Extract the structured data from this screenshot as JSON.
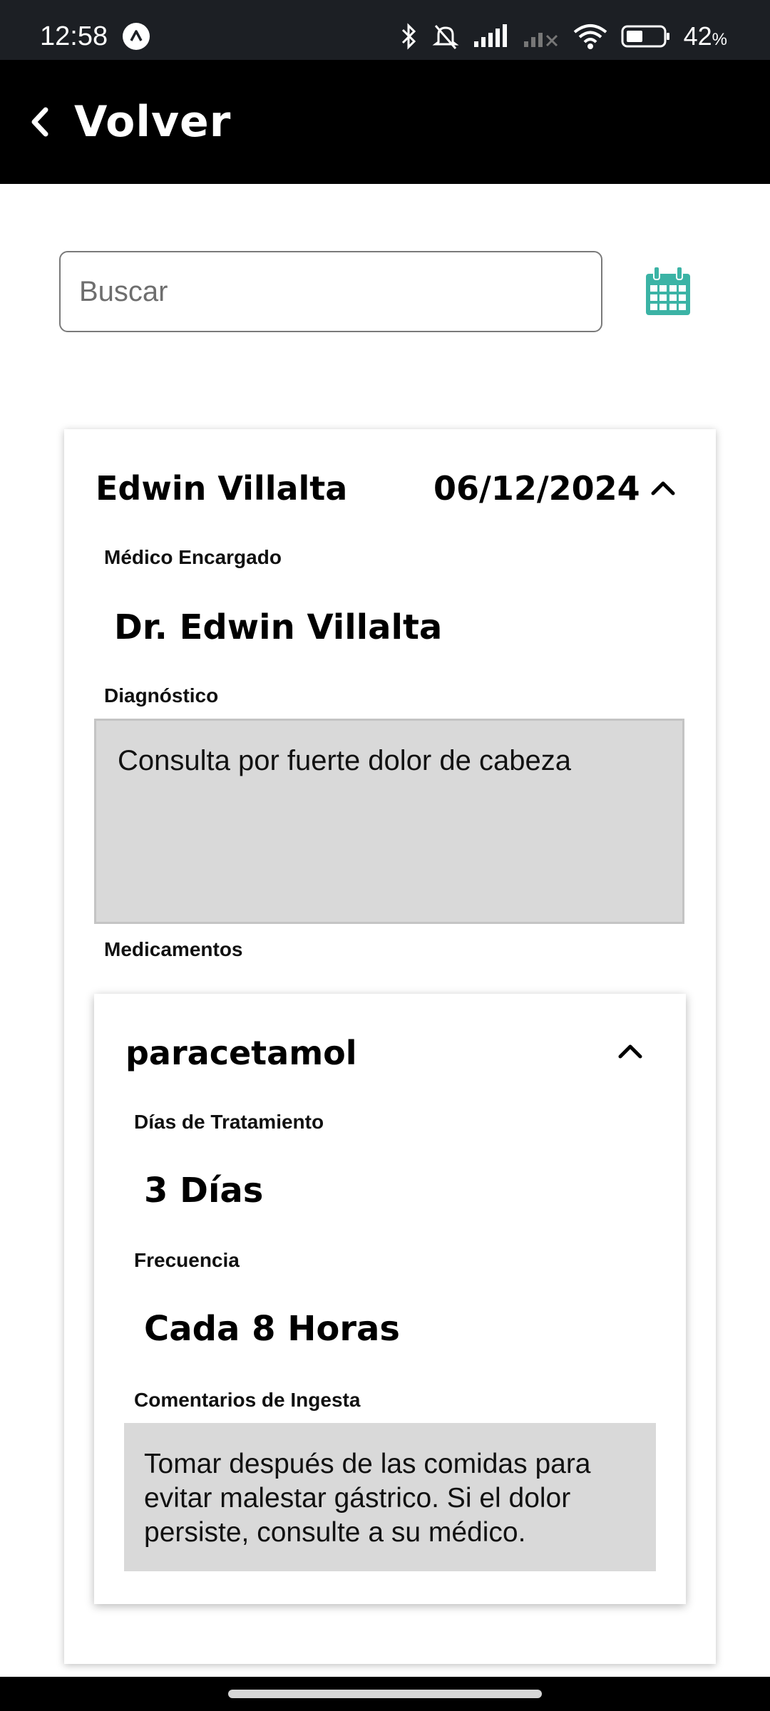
{
  "status_bar": {
    "time": "12:58",
    "battery_percent": "42",
    "battery_unit": "%",
    "icons": [
      "bluetooth-icon",
      "bell-muted-icon",
      "signal-icon",
      "signal-icon",
      "wifi-icon",
      "battery-icon"
    ]
  },
  "header": {
    "back_label": "Volver"
  },
  "search": {
    "placeholder": "Buscar",
    "value": ""
  },
  "colors": {
    "calendar_icon": "#3bb3a5",
    "header_bg": "#000000",
    "field_bg": "#d9d9d9"
  },
  "record": {
    "patient_name": "Edwin Villalta",
    "date": "06/12/2024",
    "doctor_label": "Médico Encargado",
    "doctor_value": "Dr. Edwin Villalta",
    "diagnosis_label": "Diagnóstico",
    "diagnosis_value": "Consulta por fuerte dolor de cabeza",
    "medications_label": "Medicamentos",
    "medication": {
      "name": "paracetamol",
      "days_label": "Días de Tratamiento",
      "days_value": "3 Días",
      "frequency_label": "Frecuencia",
      "frequency_value": "Cada 8 Horas",
      "comments_label": "Comentarios de Ingesta",
      "comments_value": "Tomar después de las comidas para evitar malestar gástrico. Si el dolor persiste, consulte a su médico."
    }
  }
}
